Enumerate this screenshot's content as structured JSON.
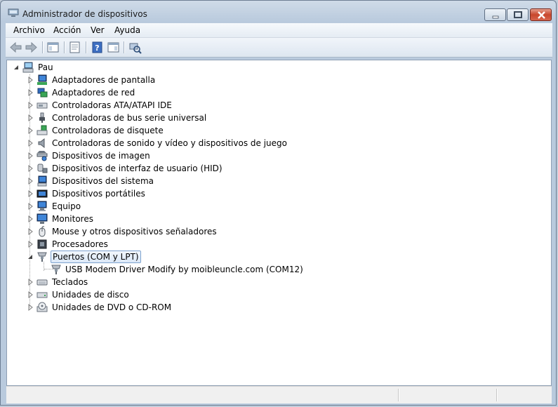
{
  "window": {
    "title": "Administrador de dispositivos"
  },
  "menu": {
    "items": [
      "Archivo",
      "Acción",
      "Ver",
      "Ayuda"
    ]
  },
  "toolbar": {
    "icons": [
      "back-arrow-icon",
      "forward-arrow-icon",
      "show-hide-console-tree-icon",
      "properties-icon",
      "help-icon",
      "action-pane-icon",
      "scan-hardware-icon"
    ]
  },
  "tree": {
    "root": "Pau",
    "categories": [
      "Adaptadores de pantalla",
      "Adaptadores de red",
      "Controladoras ATA/ATAPI IDE",
      "Controladoras de bus serie universal",
      "Controladoras de disquete",
      "Controladoras de sonido y vídeo y dispositivos de juego",
      "Dispositivos de imagen",
      "Dispositivos de interfaz de usuario (HID)",
      "Dispositivos del sistema",
      "Dispositivos portátiles",
      "Equipo",
      "Monitores",
      "Mouse y otros dispositivos señaladores",
      "Procesadores",
      "Puertos (COM y LPT)",
      "Teclados",
      "Unidades de disco",
      "Unidades de DVD o CD-ROM"
    ],
    "expanded_category": "Puertos (COM y LPT)",
    "expanded_children": [
      "USB Modem Driver Modify by moibleuncle.com (COM12)"
    ]
  },
  "colors": {
    "selection_border": "#7da2ce",
    "titlebar": "#cfdbe8",
    "close_button": "#c8472d"
  }
}
